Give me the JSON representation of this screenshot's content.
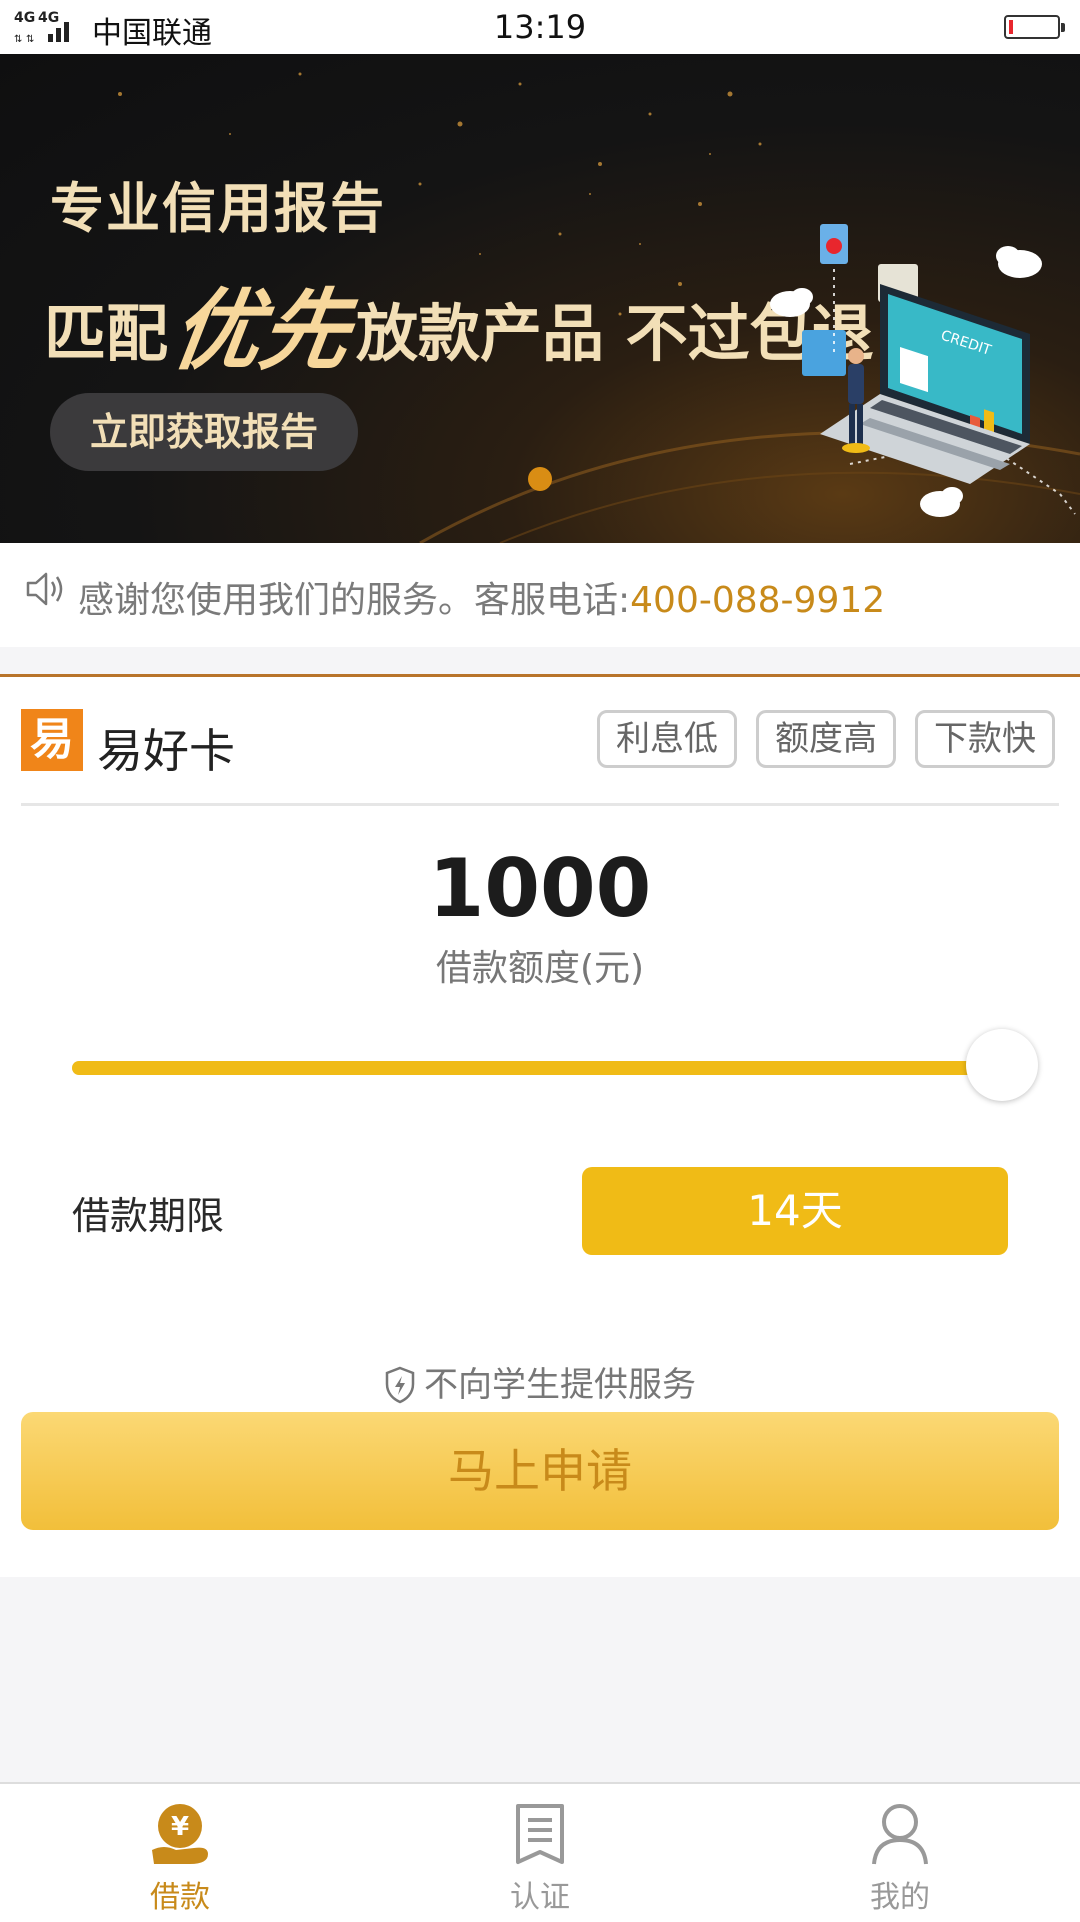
{
  "status_bar": {
    "network": "4G",
    "carrier": "中国联通",
    "time": "13:19"
  },
  "banner": {
    "line1": "专业信用报告",
    "line2_prefix": "匹配",
    "line2_highlight": "优先",
    "line2_suffix": "放款产品 不过包退",
    "cta_label": "立即获取报告",
    "illustration_screen_text": "CREDIT"
  },
  "notice": {
    "text": "感谢您使用我们的服务。客服电话:",
    "phone": "400-088-9912",
    "icon": "speaker-icon"
  },
  "card": {
    "logo_char": "易",
    "name": "易好卡",
    "tags": [
      "利息低",
      "额度高",
      "下款快"
    ],
    "amount": "1000",
    "amount_label": "借款额度(元)",
    "slider_fraction": 1.0,
    "term_label": "借款期限",
    "term_value": "14天",
    "student_notice": "不向学生提供服务",
    "apply_label": "马上申请"
  },
  "tab_bar": {
    "items": [
      {
        "label": "借款",
        "icon": "loan-yen-icon",
        "active": true
      },
      {
        "label": "认证",
        "icon": "document-icon",
        "active": false
      },
      {
        "label": "我的",
        "icon": "user-icon",
        "active": false
      }
    ]
  },
  "colors": {
    "accent": "#f0bb16",
    "accent_text": "#c88a1a",
    "logo": "#f08519",
    "banner_bg": "#141414",
    "banner_text": "#f2dfb7"
  }
}
